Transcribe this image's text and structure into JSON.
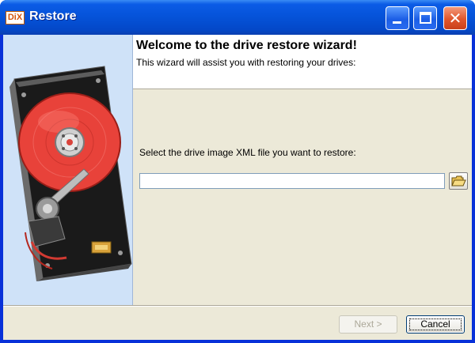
{
  "window": {
    "icon_label": "DiX",
    "title": "Restore"
  },
  "header": {
    "title": "Welcome to the drive restore wizard!",
    "subtitle": "This wizard will assist you with restoring your drives:"
  },
  "main": {
    "prompt": "Select the drive image XML file you want to restore:",
    "file_value": ""
  },
  "footer": {
    "next_label": "Next >",
    "cancel_label": "Cancel"
  },
  "colors": {
    "title_bar": "#0552d8",
    "client_bg": "#ece9d8",
    "sidebar_bg": "#cfe2f8",
    "platter": "#e8423a"
  }
}
